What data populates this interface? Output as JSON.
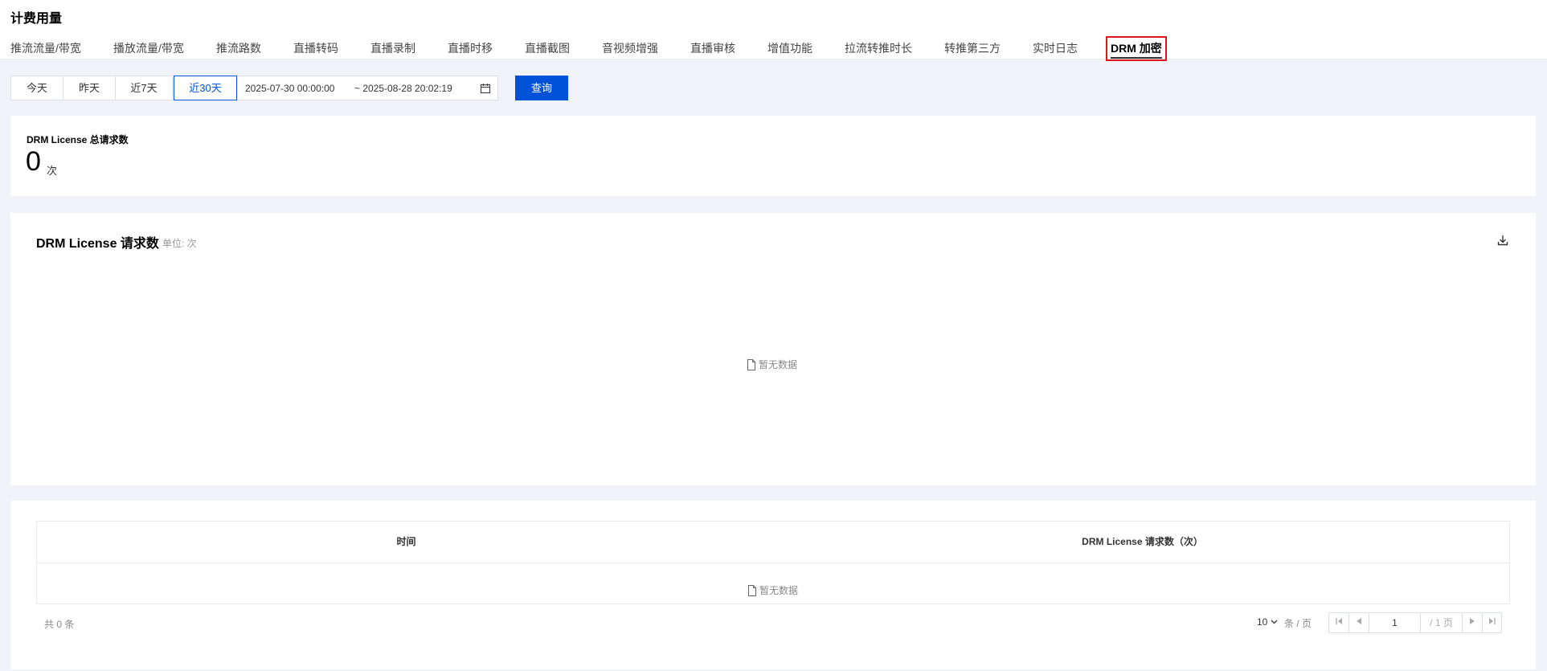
{
  "page": {
    "title": "计费用量"
  },
  "tabs": [
    {
      "label": "推流流量/带宽"
    },
    {
      "label": "播放流量/带宽"
    },
    {
      "label": "推流路数"
    },
    {
      "label": "直播转码"
    },
    {
      "label": "直播录制"
    },
    {
      "label": "直播时移"
    },
    {
      "label": "直播截图"
    },
    {
      "label": "音视频增强"
    },
    {
      "label": "直播审核"
    },
    {
      "label": "增值功能"
    },
    {
      "label": "拉流转推时长"
    },
    {
      "label": "转推第三方"
    },
    {
      "label": "实时日志"
    },
    {
      "label": "DRM 加密",
      "active": true
    }
  ],
  "filter": {
    "ranges": [
      "今天",
      "昨天",
      "近7天",
      "近30天"
    ],
    "active_range": "近30天",
    "start": "2025-07-30 00:00:00",
    "end": "~ 2025-08-28 20:02:19",
    "query_label": "查询"
  },
  "summary": {
    "label": "DRM License 总请求数",
    "value": "0",
    "unit": "次"
  },
  "chart": {
    "title": "DRM License 请求数",
    "unit": "单位: 次",
    "empty": "暂无数据",
    "download_icon": "download-icon"
  },
  "table": {
    "columns": [
      "时间",
      "DRM License 请求数（次）"
    ],
    "empty": "暂无数据",
    "total": "共 0 条",
    "page_size": "10",
    "page_size_unit": "条 / 页",
    "current_page": "1",
    "total_pages": "/ 1 页"
  },
  "colors": {
    "primary": "#0052d9",
    "highlight": "#e0141b"
  }
}
